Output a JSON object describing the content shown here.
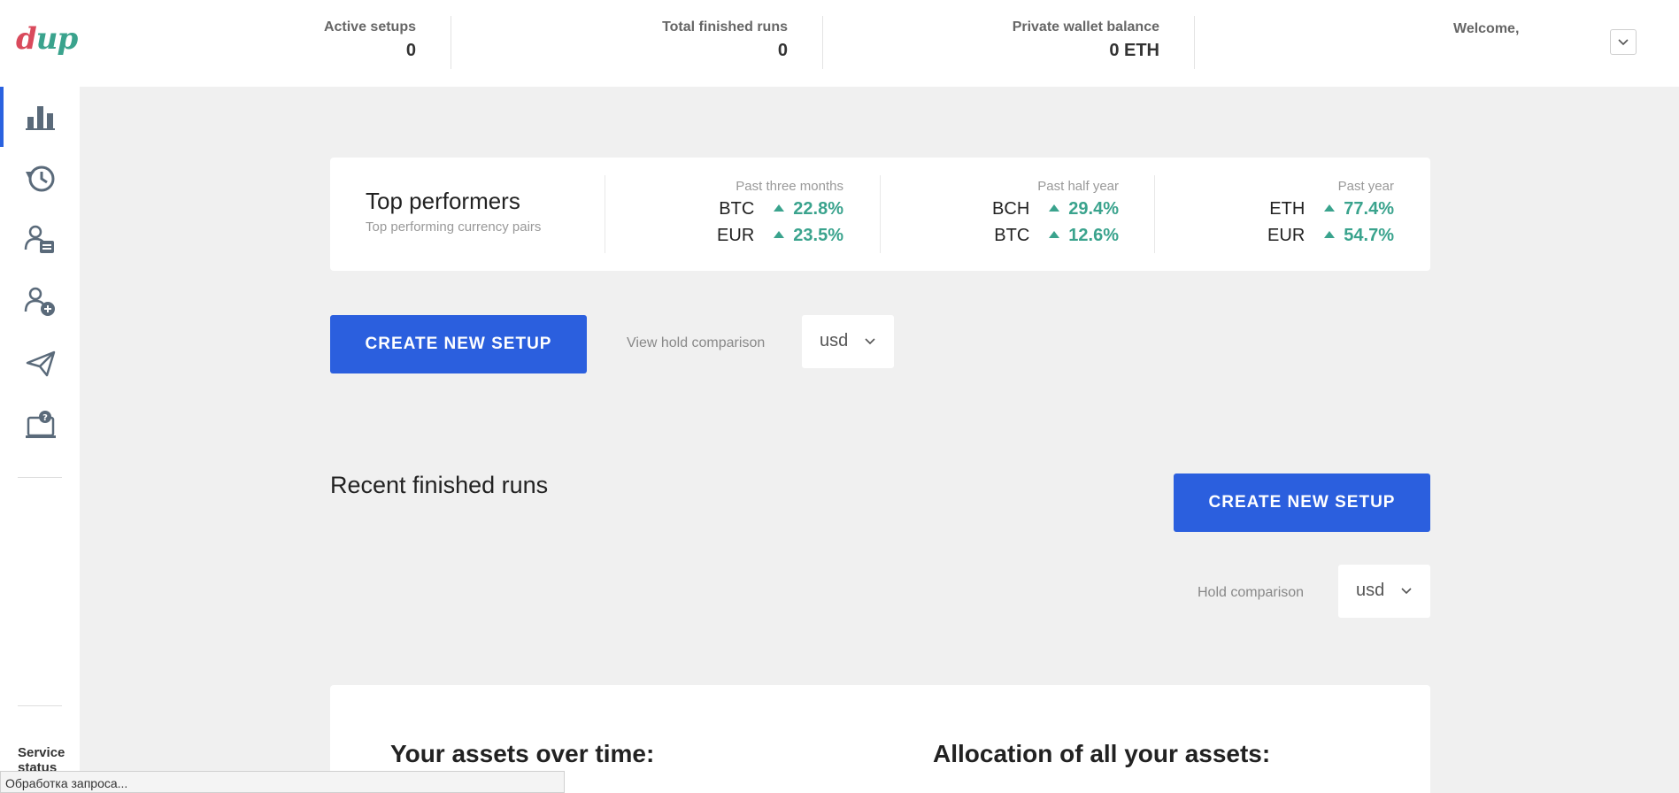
{
  "header": {
    "logo_part1": "d",
    "logo_part2": "up",
    "active_setups_label": "Active setups",
    "active_setups_value": "0",
    "total_runs_label": "Total finished runs",
    "total_runs_value": "0",
    "wallet_label": "Private wallet balance",
    "wallet_value": "0 ETH",
    "welcome": "Welcome,"
  },
  "sidebar": {
    "icons": [
      "bar-chart-icon",
      "history-icon",
      "user-list-icon",
      "add-user-icon",
      "send-icon",
      "help-desk-icon"
    ],
    "service_status": "Service status"
  },
  "top_performers": {
    "title": "Top performers",
    "subtitle": "Top performing currency pairs",
    "columns": [
      {
        "label": "Past three months",
        "rows": [
          {
            "cur": "BTC",
            "pct": "22.8%"
          },
          {
            "cur": "EUR",
            "pct": "23.5%"
          }
        ]
      },
      {
        "label": "Past half year",
        "rows": [
          {
            "cur": "BCH",
            "pct": "29.4%"
          },
          {
            "cur": "BTC",
            "pct": "12.6%"
          }
        ]
      },
      {
        "label": "Past year",
        "rows": [
          {
            "cur": "ETH",
            "pct": "77.4%"
          },
          {
            "cur": "EUR",
            "pct": "54.7%"
          }
        ]
      }
    ]
  },
  "controls": {
    "create_label": "CREATE NEW SETUP",
    "view_hold_label": "View hold comparison",
    "view_hold_value": "usd",
    "hold_label": "Hold comparison",
    "hold_value": "usd"
  },
  "recent": {
    "title": "Recent finished runs"
  },
  "assets": {
    "over_time": "Your assets over time:",
    "allocation": "Allocation of all your assets:"
  },
  "statusbar": {
    "text": "Обработка запроса..."
  },
  "colors": {
    "accent": "#2b5fde",
    "positive": "#3aa38d",
    "logo_red": "#d94a5c"
  }
}
